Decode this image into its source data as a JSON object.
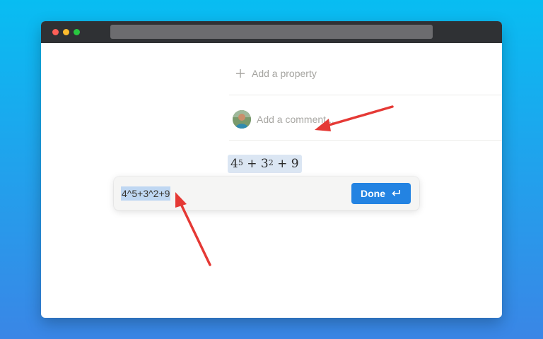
{
  "window": {
    "traffic_lights": [
      "close",
      "minimize",
      "maximize"
    ]
  },
  "page": {
    "add_property_label": "Add a property",
    "comment_placeholder": "Add a comment..."
  },
  "equation": {
    "base1": "4",
    "exp1": "5",
    "op1": " + ",
    "base2": "3",
    "exp2": "2",
    "op2": " + ",
    "term3": "9"
  },
  "editor": {
    "input_value": "4^5+3^2+9",
    "done_label": "Done",
    "done_icon": "enter-return-icon"
  },
  "colors": {
    "accent": "#2383e2",
    "annotation_arrow": "#e53935",
    "selection": "#bfd7f2"
  }
}
